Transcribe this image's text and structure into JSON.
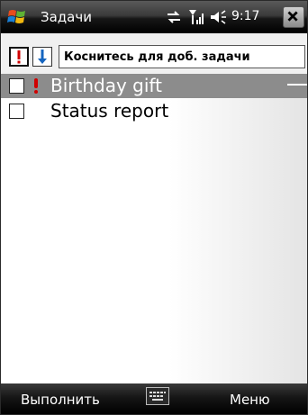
{
  "titlebar": {
    "title": "Задачи",
    "time": "9:17",
    "close_icon": "close-icon",
    "start_icon": "windows-start-icon"
  },
  "entry": {
    "high_priority_icon": "exclamation-icon",
    "low_priority_icon": "down-arrow-icon",
    "placeholder": "Коснитесь для доб. задачи"
  },
  "tasks": [
    {
      "label": "Birthday gift",
      "checked": false,
      "priority": "high",
      "selected": true
    },
    {
      "label": "Status report",
      "checked": false,
      "priority": "normal",
      "selected": false
    }
  ],
  "softkeys": {
    "left": "Выполнить",
    "right": "Меню",
    "center_icon": "keyboard-icon"
  },
  "colors": {
    "priority_high": "#d00000",
    "priority_low": "#1565c0",
    "selection": "#8c8c8c"
  }
}
